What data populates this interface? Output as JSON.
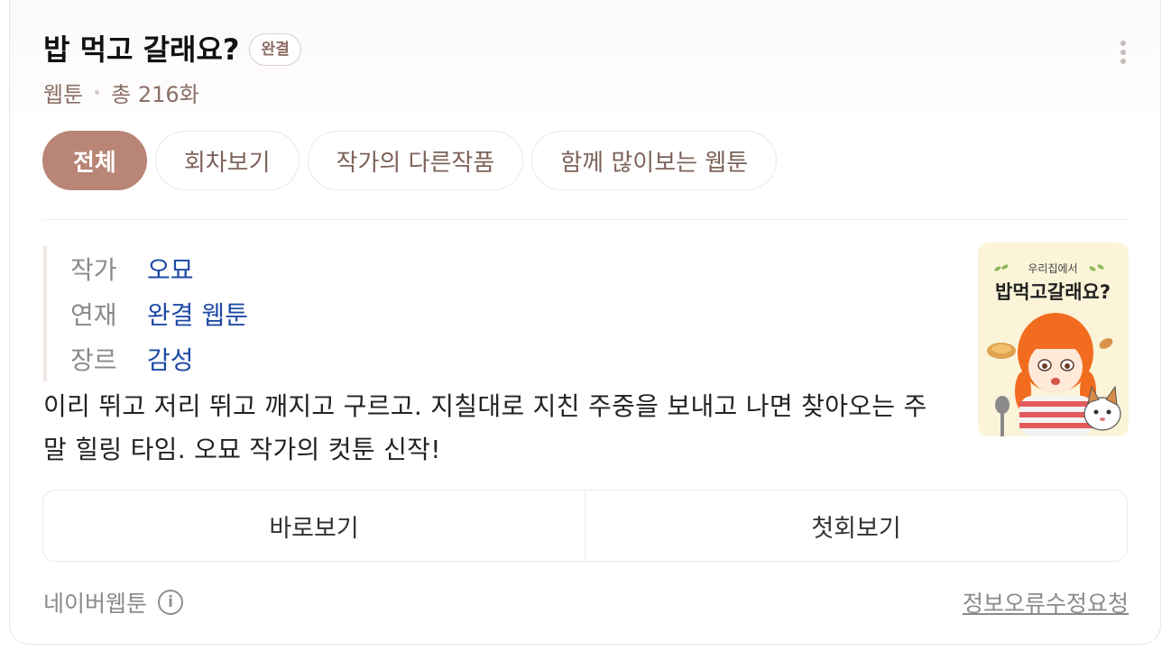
{
  "header": {
    "title": "밥 먹고 갈래요?",
    "status_badge": "완결",
    "category": "웹툰",
    "episode_count": "총 216화"
  },
  "tabs": [
    {
      "label": "전체",
      "active": true
    },
    {
      "label": "회차보기",
      "active": false
    },
    {
      "label": "작가의 다른작품",
      "active": false
    },
    {
      "label": "함께 많이보는 웹툰",
      "active": false
    }
  ],
  "info": [
    {
      "label": "작가",
      "value": "오묘"
    },
    {
      "label": "연재",
      "value": "완결 웹툰"
    },
    {
      "label": "장르",
      "value": "감성"
    }
  ],
  "poster": {
    "subtitle": "우리집에서",
    "title": "밥먹고갈래요?"
  },
  "description": "이리 뛰고 저리 뛰고 깨지고 구르고. 지칠대로 지친 주중을 보내고 나면 찾아오는 주말 힐링 타임. 오묘 작가의 컷툰 신작!",
  "actions": {
    "read_now": "바로보기",
    "first_episode": "첫회보기"
  },
  "footer": {
    "source": "네이버웹툰",
    "info_icon_glyph": "i",
    "report_link": "정보오류수정요청"
  },
  "colors": {
    "accent": "#b88577",
    "link": "#1f4aa5",
    "badge_text": "#8b6c62"
  }
}
